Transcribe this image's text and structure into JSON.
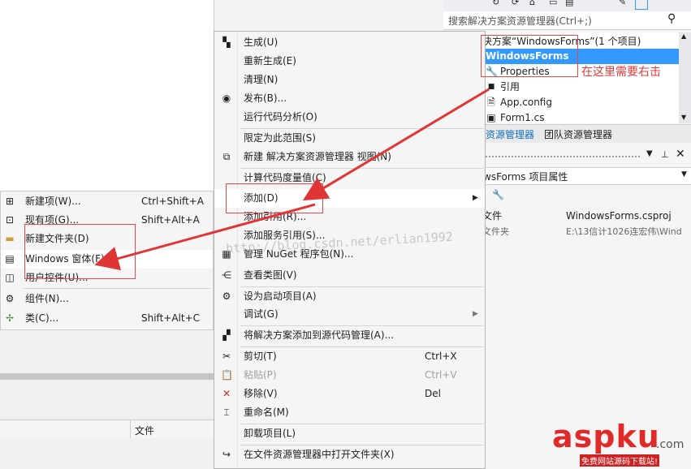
{
  "solution_explorer": {
    "search_placeholder": "搜索解决方案资源管理器(Ctrl+;)",
    "items": [
      {
        "label": "决方案“WindowsForms”(1 个项目)"
      },
      {
        "label": "WindowsForms"
      },
      {
        "label": "Properties"
      },
      {
        "label": "引用"
      },
      {
        "label": "App.config"
      },
      {
        "label": "Form1.cs"
      }
    ],
    "tabs": [
      "资源管理器",
      "团队资源管理器"
    ]
  },
  "properties": {
    "title": "wsForms 项目属性",
    "rows": [
      {
        "name": "文件",
        "value": "WindowsForms.csproj"
      },
      {
        "name": "文件夹",
        "value": "E:\\13信计1026连宏伟\\Wind"
      }
    ]
  },
  "context_menu": {
    "items": [
      {
        "label": "生成(U)",
        "shortcut": "",
        "icon": "build-icon"
      },
      {
        "label": "重新生成(E)",
        "shortcut": "",
        "icon": ""
      },
      {
        "label": "清理(N)",
        "shortcut": "",
        "icon": ""
      },
      {
        "label": "发布(B)...",
        "shortcut": "",
        "icon": "publish-icon"
      },
      {
        "label": "运行代码分析(O)",
        "shortcut": "",
        "icon": ""
      },
      {
        "label": "限定为此范围(S)",
        "shortcut": "",
        "icon": ""
      },
      {
        "label": "新建 解决方案资源管理器 视图(N)",
        "shortcut": "",
        "icon": "new-view-icon"
      },
      {
        "label": "计算代码度量值(C)",
        "shortcut": "",
        "icon": ""
      },
      {
        "label": "添加(D)",
        "shortcut": "",
        "icon": ""
      },
      {
        "label": "添加引用(R)...",
        "shortcut": "",
        "icon": ""
      },
      {
        "label": "添加服务引用(S)...",
        "shortcut": "",
        "icon": ""
      },
      {
        "label": "管理 NuGet 程序包(N)...",
        "shortcut": "",
        "icon": "nuget-icon"
      },
      {
        "label": "查看类图(V)",
        "shortcut": "",
        "icon": "class-diagram-icon"
      },
      {
        "label": "设为启动项目(A)",
        "shortcut": "",
        "icon": "startup-gear-icon"
      },
      {
        "label": "调试(G)",
        "shortcut": "",
        "icon": ""
      },
      {
        "label": "将解决方案添加到源代码管理(A)...",
        "shortcut": "",
        "icon": "source-control-icon"
      },
      {
        "label": "剪切(T)",
        "shortcut": "Ctrl+X",
        "icon": "scissors-icon"
      },
      {
        "label": "粘贴(P)",
        "shortcut": "Ctrl+V",
        "icon": "paste-icon"
      },
      {
        "label": "移除(V)",
        "shortcut": "Del",
        "icon": "remove-icon"
      },
      {
        "label": "重命名(M)",
        "shortcut": "",
        "icon": "rename-icon"
      },
      {
        "label": "卸载项目(L)",
        "shortcut": "",
        "icon": ""
      },
      {
        "label": "在文件资源管理器中打开文件夹(X)",
        "shortcut": "",
        "icon": "open-folder-icon"
      }
    ]
  },
  "add_submenu": {
    "items": [
      {
        "label": "新建项(W)...",
        "shortcut": "Ctrl+Shift+A"
      },
      {
        "label": "现有项(G)...",
        "shortcut": "Shift+Alt+A"
      },
      {
        "label": "新建文件夹(D)",
        "shortcut": ""
      },
      {
        "label": "Windows 窗体(F)...",
        "shortcut": ""
      },
      {
        "label": "用户控件(U)...",
        "shortcut": ""
      },
      {
        "label": "组件(N)...",
        "shortcut": ""
      },
      {
        "label": "类(C)...",
        "shortcut": "Shift+Alt+C"
      }
    ]
  },
  "left_panel": {
    "column_header": "文件"
  },
  "annotations": {
    "callout": "在这里需要右击",
    "watermark": "http://blog.csdn.net/erlian1992",
    "logo_main": "aspku",
    "logo_tld": ".com",
    "logo_sub": "免费网站源码下载站!"
  },
  "colors": {
    "selection": "#3399ff",
    "annotation": "#e84848",
    "menu_bg": "#f5f5f5"
  }
}
